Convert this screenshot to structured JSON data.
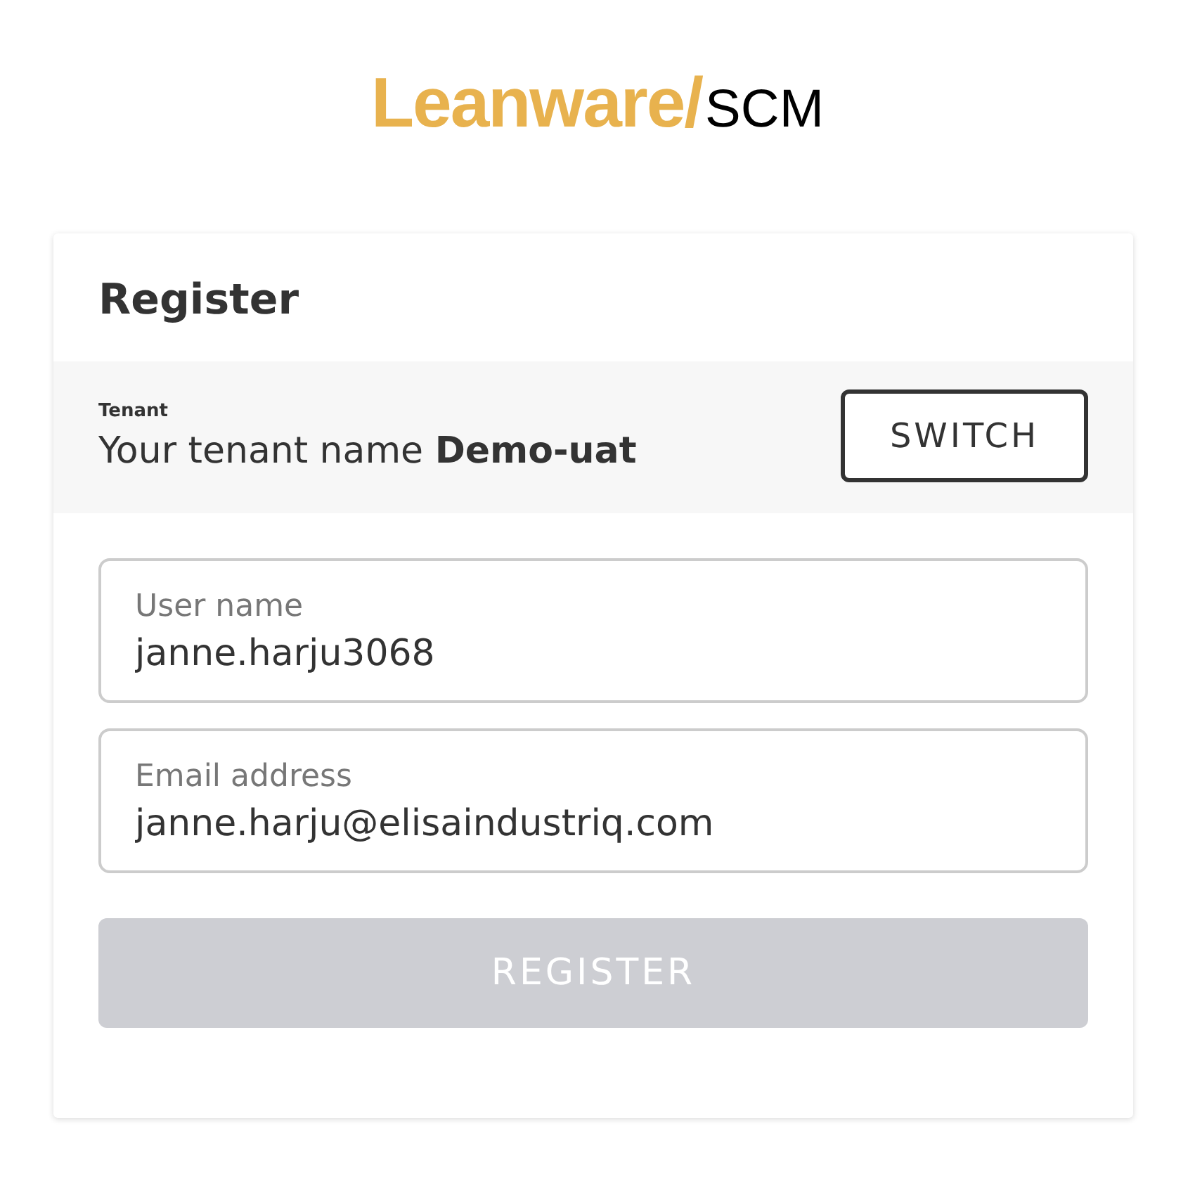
{
  "logo": {
    "brand": "Leanware/",
    "product": "SCM"
  },
  "title": "Register",
  "tenant": {
    "label": "Tenant",
    "text": "Your tenant name **Demo-uat**",
    "button": "SWITCH"
  },
  "fields": [
    {
      "label": "User name",
      "value": "janne.harju3068"
    },
    {
      "label": "Email address",
      "value": "janne.harju@elisaindustriq.com"
    }
  ],
  "submit": {
    "label": "REGISTER",
    "disabled": true
  }
}
